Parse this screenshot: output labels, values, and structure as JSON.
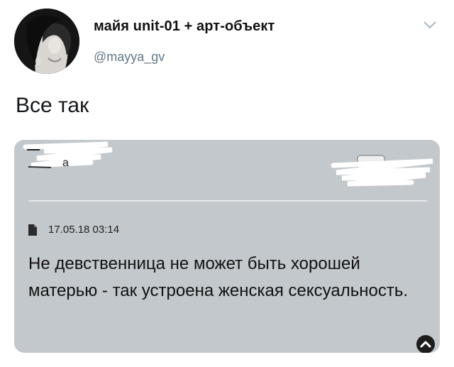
{
  "author": {
    "name": "майя unit-01 + арт-объект",
    "handle": "@mayya_gv"
  },
  "tweet": {
    "text": "Все так"
  },
  "attached_screenshot": {
    "cropped_word": "а",
    "date": "17.05.18 03:14",
    "quote": "Не девственница не может быть хорошей матерью - так устроена женская сексуальность."
  },
  "icons": {
    "menu": "chevron-down-icon",
    "document": "document-icon",
    "scroll": "chevron-up-icon"
  },
  "colors": {
    "handle": "#657786",
    "card_background": "#c3c8cc"
  }
}
